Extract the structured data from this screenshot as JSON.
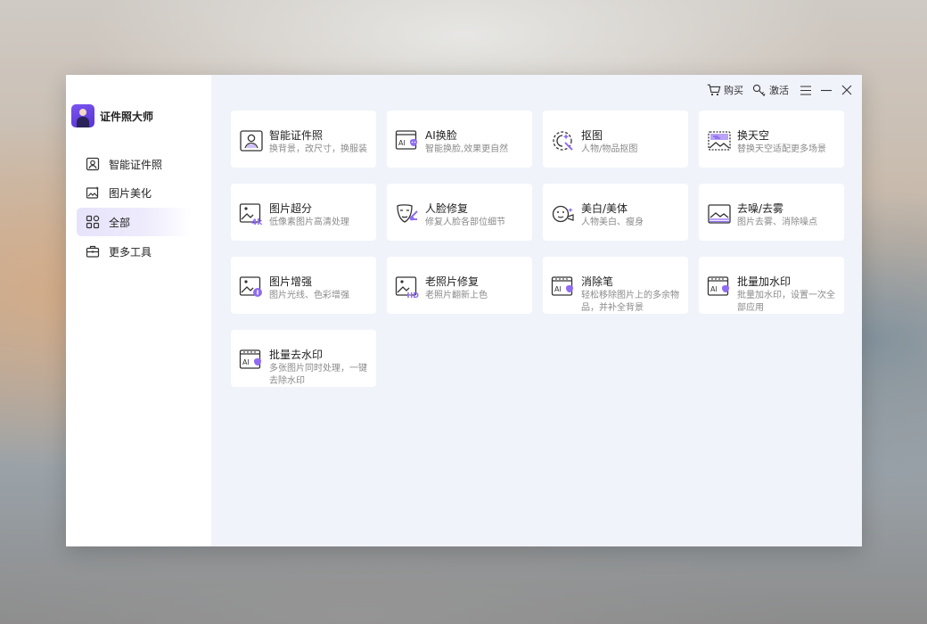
{
  "app": {
    "name": "证件照大师"
  },
  "topbar": {
    "buy_label": "购买",
    "activate_label": "激活"
  },
  "sidebar": {
    "items": [
      {
        "label": "智能证件照",
        "icon": "id-photo-icon"
      },
      {
        "label": "图片美化",
        "icon": "image-beautify-icon"
      },
      {
        "label": "全部",
        "icon": "grid-icon",
        "active": true
      },
      {
        "label": "更多工具",
        "icon": "toolbox-icon"
      }
    ]
  },
  "tools": [
    {
      "title": "智能证件照",
      "desc": "换背景，改尺寸，换服装",
      "icon": "id-photo-icon"
    },
    {
      "title": "AI换脸",
      "desc": "智能换脸,效果更自然",
      "icon": "ai-face-swap-icon"
    },
    {
      "title": "抠图",
      "desc": "人物/物品抠图",
      "icon": "cutout-icon"
    },
    {
      "title": "换天空",
      "desc": "替换天空适配更多场景",
      "icon": "sky-replace-icon"
    },
    {
      "title": "图片超分",
      "desc": "低像素图片高清处理",
      "icon": "super-resolution-icon"
    },
    {
      "title": "人脸修复",
      "desc": "修复人脸各部位细节",
      "icon": "face-repair-icon"
    },
    {
      "title": "美白/美体",
      "desc": "人物美白、瘦身",
      "icon": "whiten-body-icon"
    },
    {
      "title": "去噪/去雾",
      "desc": "图片去雾、消除噪点",
      "icon": "denoise-icon"
    },
    {
      "title": "图片增强",
      "desc": "图片光线、色彩增强",
      "icon": "enhance-icon"
    },
    {
      "title": "老照片修复",
      "desc": "老照片翻新上色",
      "icon": "old-photo-hd-icon"
    },
    {
      "title": "消除笔",
      "desc": "轻松移除图片上的多余物品，并补全背景",
      "icon": "eraser-ai-icon"
    },
    {
      "title": "批量加水印",
      "desc": "批量加水印，设置一次全部应用",
      "icon": "batch-watermark-add-icon"
    },
    {
      "title": "批量去水印",
      "desc": "多张图片同时处理，一键去除水印",
      "icon": "batch-watermark-remove-icon"
    }
  ],
  "colors": {
    "accent": "#7b55ef",
    "window_bg": "#f1f3fb",
    "sidebar_active": "#e6e3fb"
  }
}
